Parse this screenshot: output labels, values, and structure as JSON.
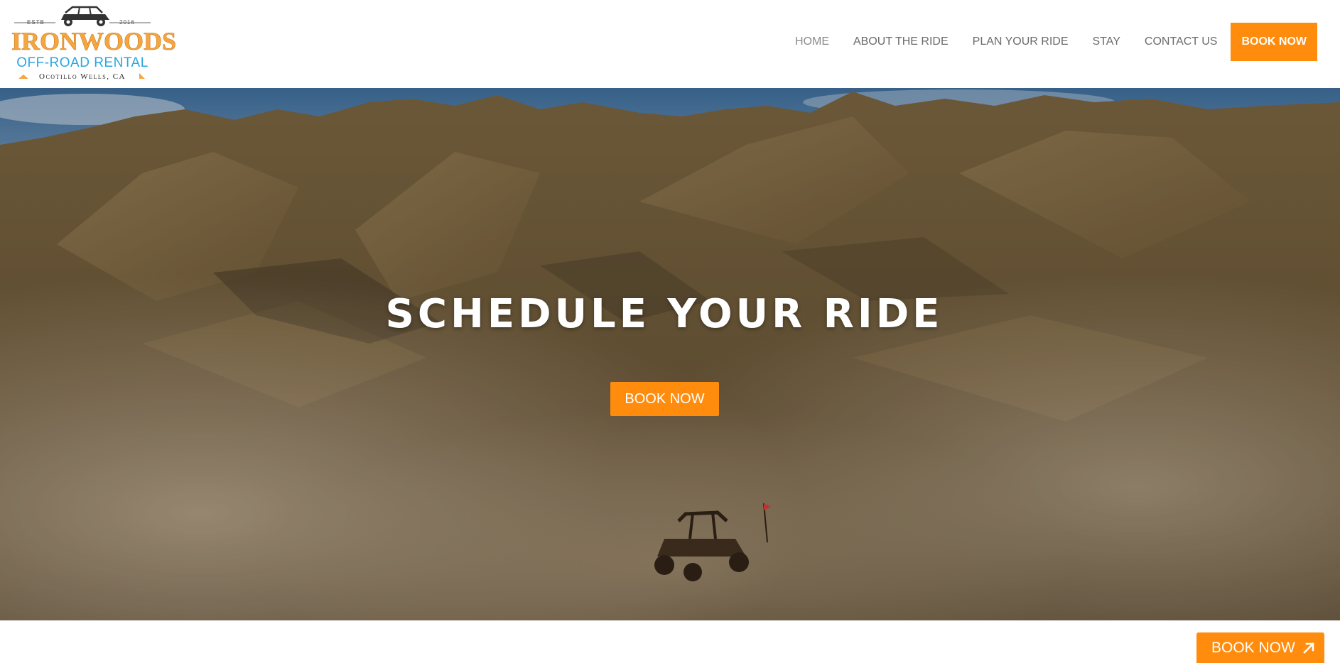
{
  "brand": {
    "estb": "ESTB",
    "year": "2016",
    "name": "IRONWOODS",
    "subtitle": "OFF-ROAD RENTAL",
    "location": "Ocotillo Wells, CA",
    "primary_color": "#f5a641",
    "secondary_color": "#2aa6df"
  },
  "nav": {
    "items": [
      {
        "label": "HOME",
        "active": true
      },
      {
        "label": "ABOUT THE RIDE",
        "active": false
      },
      {
        "label": "PLAN YOUR RIDE",
        "active": false
      },
      {
        "label": "STAY",
        "active": false
      },
      {
        "label": "CONTACT US",
        "active": false
      }
    ],
    "cta_label": "BOOK NOW",
    "cta_color": "#ff8c0d"
  },
  "hero": {
    "title": "SCHEDULE YOUR RIDE",
    "button_label": "BOOK NOW",
    "background": "desert-mountains-offroad-vehicle-photo"
  },
  "floating_cta": {
    "label": "BOOK NOW",
    "icon": "arrow-up-right-icon"
  }
}
